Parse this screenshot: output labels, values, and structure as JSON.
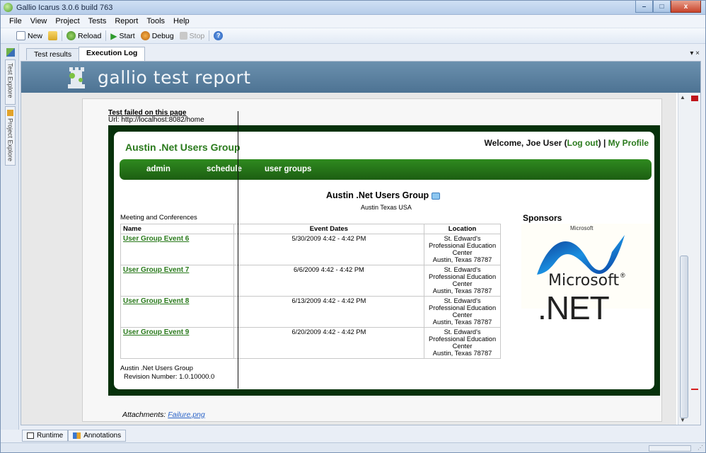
{
  "window": {
    "title": "Gallio Icarus 3.0.6 build 763",
    "min": "–",
    "max": "□",
    "close": "x"
  },
  "menu": [
    "File",
    "View",
    "Project",
    "Tests",
    "Report",
    "Tools",
    "Help"
  ],
  "toolbar": {
    "new": "New",
    "reload": "Reload",
    "start": "Start",
    "debug": "Debug",
    "stop": "Stop"
  },
  "left_tabs": {
    "test_explorer": "Test Explore",
    "project_explorer": "Project Explore"
  },
  "tabs": [
    {
      "label": "Test results"
    },
    {
      "label": "Execution Log"
    }
  ],
  "tab_controls": "▾ ×",
  "banner": {
    "title": "gallio test report"
  },
  "report": {
    "fail_heading": "Test failed on this page",
    "fail_url": "Url: http://localhost:8082/home",
    "attachments_label": "Attachments:",
    "attachment_file": "Failure.png"
  },
  "site": {
    "name": "Austin .Net Users Group",
    "welcome_prefix": "Welcome, Joe User (",
    "logout": "Log out",
    "welcome_suffix": ") | ",
    "my_profile": "My Profile",
    "nav": [
      "admin",
      "schedule",
      "user groups"
    ],
    "group_title": "Austin .Net Users Group",
    "group_location": "Austin Texas USA",
    "section_label": "Meeting and Conferences",
    "table": {
      "headers": [
        "Name",
        "Event Dates",
        "Location"
      ],
      "rows": [
        {
          "name": "User Group Event 6",
          "date": "5/30/2009 4:42 - 4:42 PM"
        },
        {
          "name": "User Group Event 7",
          "date": "6/6/2009 4:42 - 4:42 PM"
        },
        {
          "name": "User Group Event 8",
          "date": "6/13/2009 4:42 - 4:42 PM"
        },
        {
          "name": "User Group Event 9",
          "date": "6/20/2009 4:42 - 4:42 PM"
        }
      ],
      "location_lines": [
        "St. Edward's",
        "Professional Education",
        "Center",
        "Austin, Texas 78787"
      ]
    },
    "footer_name": "Austin .Net Users Group",
    "footer_revision": "Revision Number: 1.0.10000.0",
    "sponsors_label": "Sponsors",
    "sponsor": {
      "small": "Microsoft",
      "word": "Microsoft",
      "net": ".NET",
      "tm": "®"
    }
  },
  "bottom_tabs": [
    "Runtime",
    "Annotations"
  ],
  "colors": {
    "site_green": "#2a7a1c",
    "nav_green": "#1c5e12",
    "banner": "#5a7f9f"
  }
}
